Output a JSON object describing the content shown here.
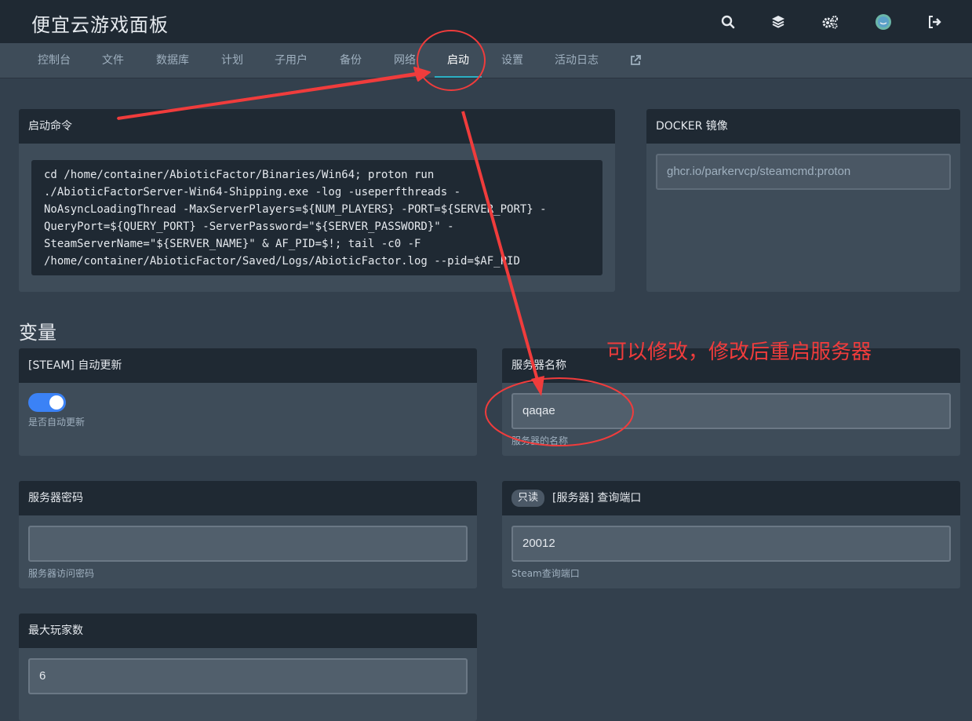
{
  "app": {
    "title": "便宜云游戏面板"
  },
  "top_icons": [
    "search-icon",
    "layers-icon",
    "cogs-icon",
    "avatar",
    "logout-icon"
  ],
  "tabs": [
    {
      "label": "控制台"
    },
    {
      "label": "文件"
    },
    {
      "label": "数据库"
    },
    {
      "label": "计划"
    },
    {
      "label": "子用户"
    },
    {
      "label": "备份"
    },
    {
      "label": "网络"
    },
    {
      "label": "启动"
    },
    {
      "label": "设置"
    },
    {
      "label": "活动日志"
    }
  ],
  "active_tab": "启动",
  "startup": {
    "title": "启动命令",
    "command": "cd /home/container/AbioticFactor/Binaries/Win64; proton run\n./AbioticFactorServer-Win64-Shipping.exe -log -useperfthreads -\nNoAsyncLoadingThread -MaxServerPlayers=${NUM_PLAYERS} -PORT=${SERVER_PORT} -\nQueryPort=${QUERY_PORT} -ServerPassword=\"${SERVER_PASSWORD}\" -\nSteamServerName=\"${SERVER_NAME}\" & AF_PID=$!; tail -c0 -F\n/home/container/AbioticFactor/Saved/Logs/AbioticFactor.log --pid=$AF_PID"
  },
  "docker": {
    "title": "DOCKER 镜像",
    "value": "ghcr.io/parkervcp/steamcmd:proton"
  },
  "variables": {
    "title": "变量",
    "steam_update": {
      "title": "[STEAM] 自动更新",
      "enabled": true,
      "help": "是否自动更新"
    },
    "server_name": {
      "title": "服务器名称",
      "value": "qaqae",
      "help": "服务器的名称"
    },
    "server_password": {
      "title": "服务器密码",
      "value": "",
      "help": "服务器访问密码"
    },
    "query_port": {
      "badge": "只读",
      "title": "[服务器] 查询端口",
      "value": "20012",
      "help": "Steam查询端口"
    },
    "max_players": {
      "title": "最大玩家数",
      "value": "6"
    }
  },
  "annotation": {
    "text": "可以修改，修改后重启服务器",
    "color": "#f03c3c"
  }
}
